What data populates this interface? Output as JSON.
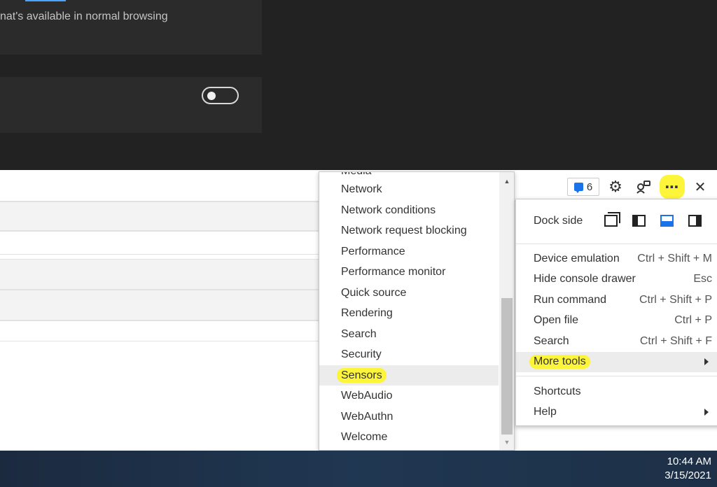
{
  "browser": {
    "card1_text": "nat's available in normal browsing",
    "toggle_on": false
  },
  "toolbar": {
    "issues_count": "6",
    "icons": [
      "message-icon",
      "gear-icon",
      "remote-devices-icon",
      "more-options-icon",
      "close-icon"
    ],
    "highlight_color": "#fdf53a"
  },
  "submenu": {
    "clipped_item": "Media",
    "items": [
      "Network",
      "Network conditions",
      "Network request blocking",
      "Performance",
      "Performance monitor",
      "Quick source",
      "Rendering",
      "Search",
      "Security",
      "Sensors",
      "WebAudio",
      "WebAuthn",
      "Welcome"
    ],
    "active_item": "Sensors"
  },
  "menu": {
    "dock_side_label": "Dock side",
    "dock_icons": [
      "undock-icon",
      "dock-left-icon",
      "dock-bottom-icon",
      "dock-right-icon"
    ],
    "selected_dock": "dock-bottom",
    "items": [
      {
        "label": "Device emulation",
        "shortcut": "Ctrl + Shift + M"
      },
      {
        "label": "Hide console drawer",
        "shortcut": "Esc"
      },
      {
        "label": "Run command",
        "shortcut": "Ctrl + Shift + P"
      },
      {
        "label": "Open file",
        "shortcut": "Ctrl + P"
      },
      {
        "label": "Search",
        "shortcut": "Ctrl + Shift + F"
      },
      {
        "label": "More tools",
        "shortcut": ""
      }
    ],
    "bottom_items": [
      {
        "label": "Shortcuts"
      },
      {
        "label": "Help"
      }
    ],
    "accent_color": "#1a73e8"
  },
  "taskbar": {
    "time": "10:44 AM",
    "date": "3/15/2021"
  }
}
